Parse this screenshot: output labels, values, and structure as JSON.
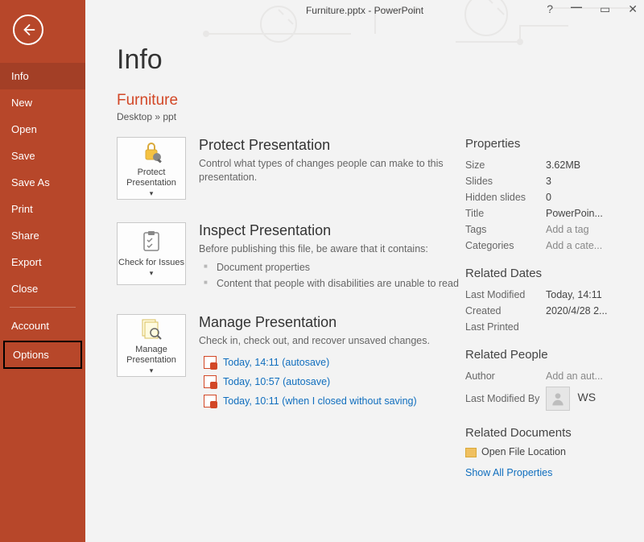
{
  "titlebar": "Furniture.pptx - PowerPoint",
  "sidebar": {
    "items": [
      "Info",
      "New",
      "Open",
      "Save",
      "Save As",
      "Print",
      "Share",
      "Export",
      "Close"
    ],
    "account": "Account",
    "options": "Options"
  },
  "page": {
    "heading": "Info",
    "docTitle": "Furniture",
    "docPath": "Desktop » ppt"
  },
  "protect": {
    "btn": "Protect Presentation",
    "title": "Protect Presentation",
    "desc": "Control what types of changes people can make to this presentation."
  },
  "inspect": {
    "btn": "Check for Issues",
    "title": "Inspect Presentation",
    "desc": "Before publishing this file, be aware that it contains:",
    "b1": "Document properties",
    "b2": "Content that people with disabilities are unable to read"
  },
  "manage": {
    "btn": "Manage Presentation",
    "title": "Manage Presentation",
    "desc": "Check in, check out, and recover unsaved changes.",
    "v1": "Today, 14:11 (autosave)",
    "v2": "Today, 10:57 (autosave)",
    "v3": "Today, 10:11 (when I closed without saving)"
  },
  "props": {
    "head": "Properties",
    "size_k": "Size",
    "size_v": "3.62MB",
    "slides_k": "Slides",
    "slides_v": "3",
    "hidden_k": "Hidden slides",
    "hidden_v": "0",
    "title_k": "Title",
    "title_v": "PowerPoin...",
    "tags_k": "Tags",
    "tags_v": "Add a tag",
    "cats_k": "Categories",
    "cats_v": "Add a cate...",
    "dates_head": "Related Dates",
    "lm_k": "Last Modified",
    "lm_v": "Today, 14:11",
    "cr_k": "Created",
    "cr_v": "2020/4/28 2...",
    "lp_k": "Last Printed",
    "lp_v": "",
    "people_head": "Related People",
    "author_k": "Author",
    "author_v": "Add an aut...",
    "lmb_k": "Last Modified By",
    "lmb_v": "WS",
    "docs_head": "Related Documents",
    "openloc": "Open File Location",
    "showall": "Show All Properties"
  }
}
